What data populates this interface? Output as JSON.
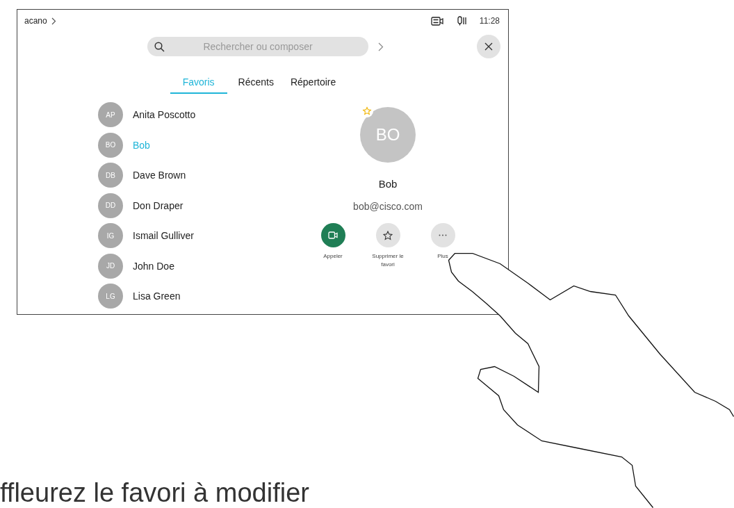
{
  "status_bar": {
    "device": "acano",
    "time": "11:28"
  },
  "search": {
    "placeholder": "Rechercher ou composer"
  },
  "tabs": [
    {
      "label": "Favoris",
      "selected": true
    },
    {
      "label": "Récents",
      "selected": false
    },
    {
      "label": "Répertoire",
      "selected": false
    }
  ],
  "contacts": [
    {
      "initials": "AP",
      "name": "Anita Poscotto",
      "selected": false
    },
    {
      "initials": "BO",
      "name": "Bob",
      "selected": true
    },
    {
      "initials": "DB",
      "name": "Dave Brown",
      "selected": false
    },
    {
      "initials": "DD",
      "name": "Don Draper",
      "selected": false
    },
    {
      "initials": "IG",
      "name": "Ismail Gulliver",
      "selected": false
    },
    {
      "initials": "JD",
      "name": "John Doe",
      "selected": false
    },
    {
      "initials": "LG",
      "name": "Lisa Green",
      "selected": false
    }
  ],
  "detail": {
    "initials": "BO",
    "favorite": true,
    "name": "Bob",
    "email": "bob@cisco.com",
    "actions": [
      {
        "kind": "call",
        "label": "Appeler"
      },
      {
        "kind": "unfavorite",
        "label": "Supprimer le favori"
      },
      {
        "kind": "more",
        "label": "Plus"
      }
    ]
  },
  "caption": "ffleurez le favori à modifier"
}
